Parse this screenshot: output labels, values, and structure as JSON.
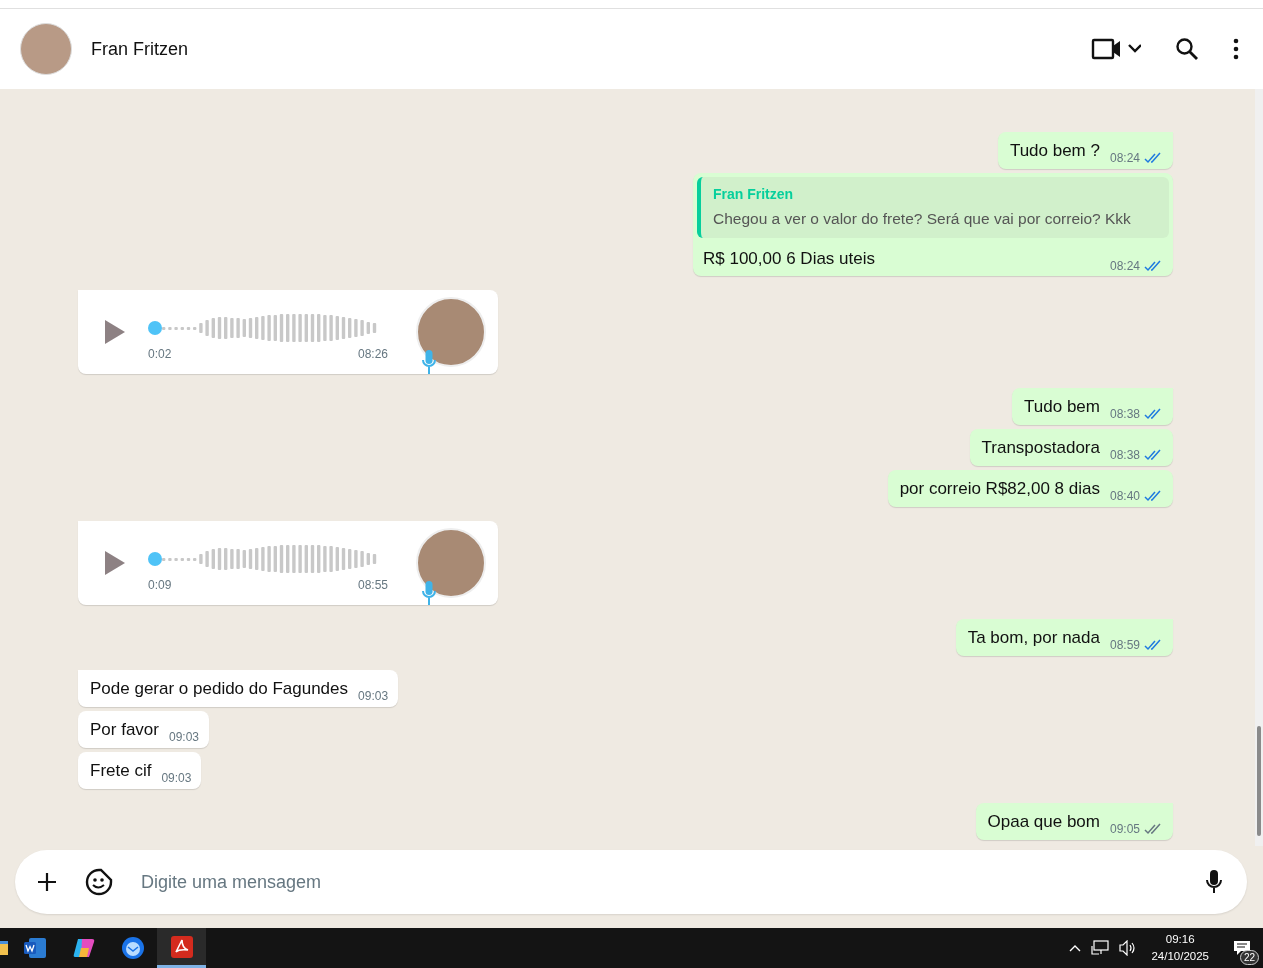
{
  "header": {
    "contact_name": "Fran Fritzen"
  },
  "messages": [
    {
      "kind": "text",
      "outgoing": true,
      "text": "Tudo bem ?",
      "time": "08:24",
      "read": true
    },
    {
      "kind": "reply",
      "outgoing": true,
      "quote_author": "Fran Fritzen",
      "quote_text": "Chegou a ver o valor do frete? Será que vai por correio? Kkk",
      "text": "R$ 100,00 6 Dias uteis",
      "time": "08:24",
      "read": true
    },
    {
      "kind": "audio",
      "outgoing": false,
      "duration": "0:02",
      "time": "08:26",
      "level": 0
    },
    {
      "kind": "text",
      "outgoing": true,
      "text": "Tudo bem",
      "time": "08:38",
      "read": true
    },
    {
      "kind": "text",
      "outgoing": true,
      "text": "Transpostadora",
      "time": "08:38",
      "read": true
    },
    {
      "kind": "text",
      "outgoing": true,
      "text": "por correio R$82,00 8 dias",
      "time": "08:40",
      "read": true
    },
    {
      "kind": "audio",
      "outgoing": false,
      "duration": "0:09",
      "time": "08:55",
      "level": 0
    },
    {
      "kind": "text",
      "outgoing": true,
      "text": "Ta bom, por nada",
      "time": "08:59",
      "read": true
    },
    {
      "kind": "text",
      "outgoing": false,
      "text": "Pode gerar o pedido do Fagundes",
      "time": "09:03"
    },
    {
      "kind": "text",
      "outgoing": false,
      "text": "Por favor",
      "time": "09:03"
    },
    {
      "kind": "text",
      "outgoing": false,
      "text": "Frete cif",
      "time": "09:03"
    },
    {
      "kind": "text",
      "outgoing": true,
      "text": "Opaa que bom",
      "time": "09:05",
      "read": false
    }
  ],
  "composer": {
    "placeholder": "Digite uma mensagem"
  },
  "taskbar": {
    "time": "09:16",
    "date": "24/10/2025",
    "notification_count": "22"
  }
}
